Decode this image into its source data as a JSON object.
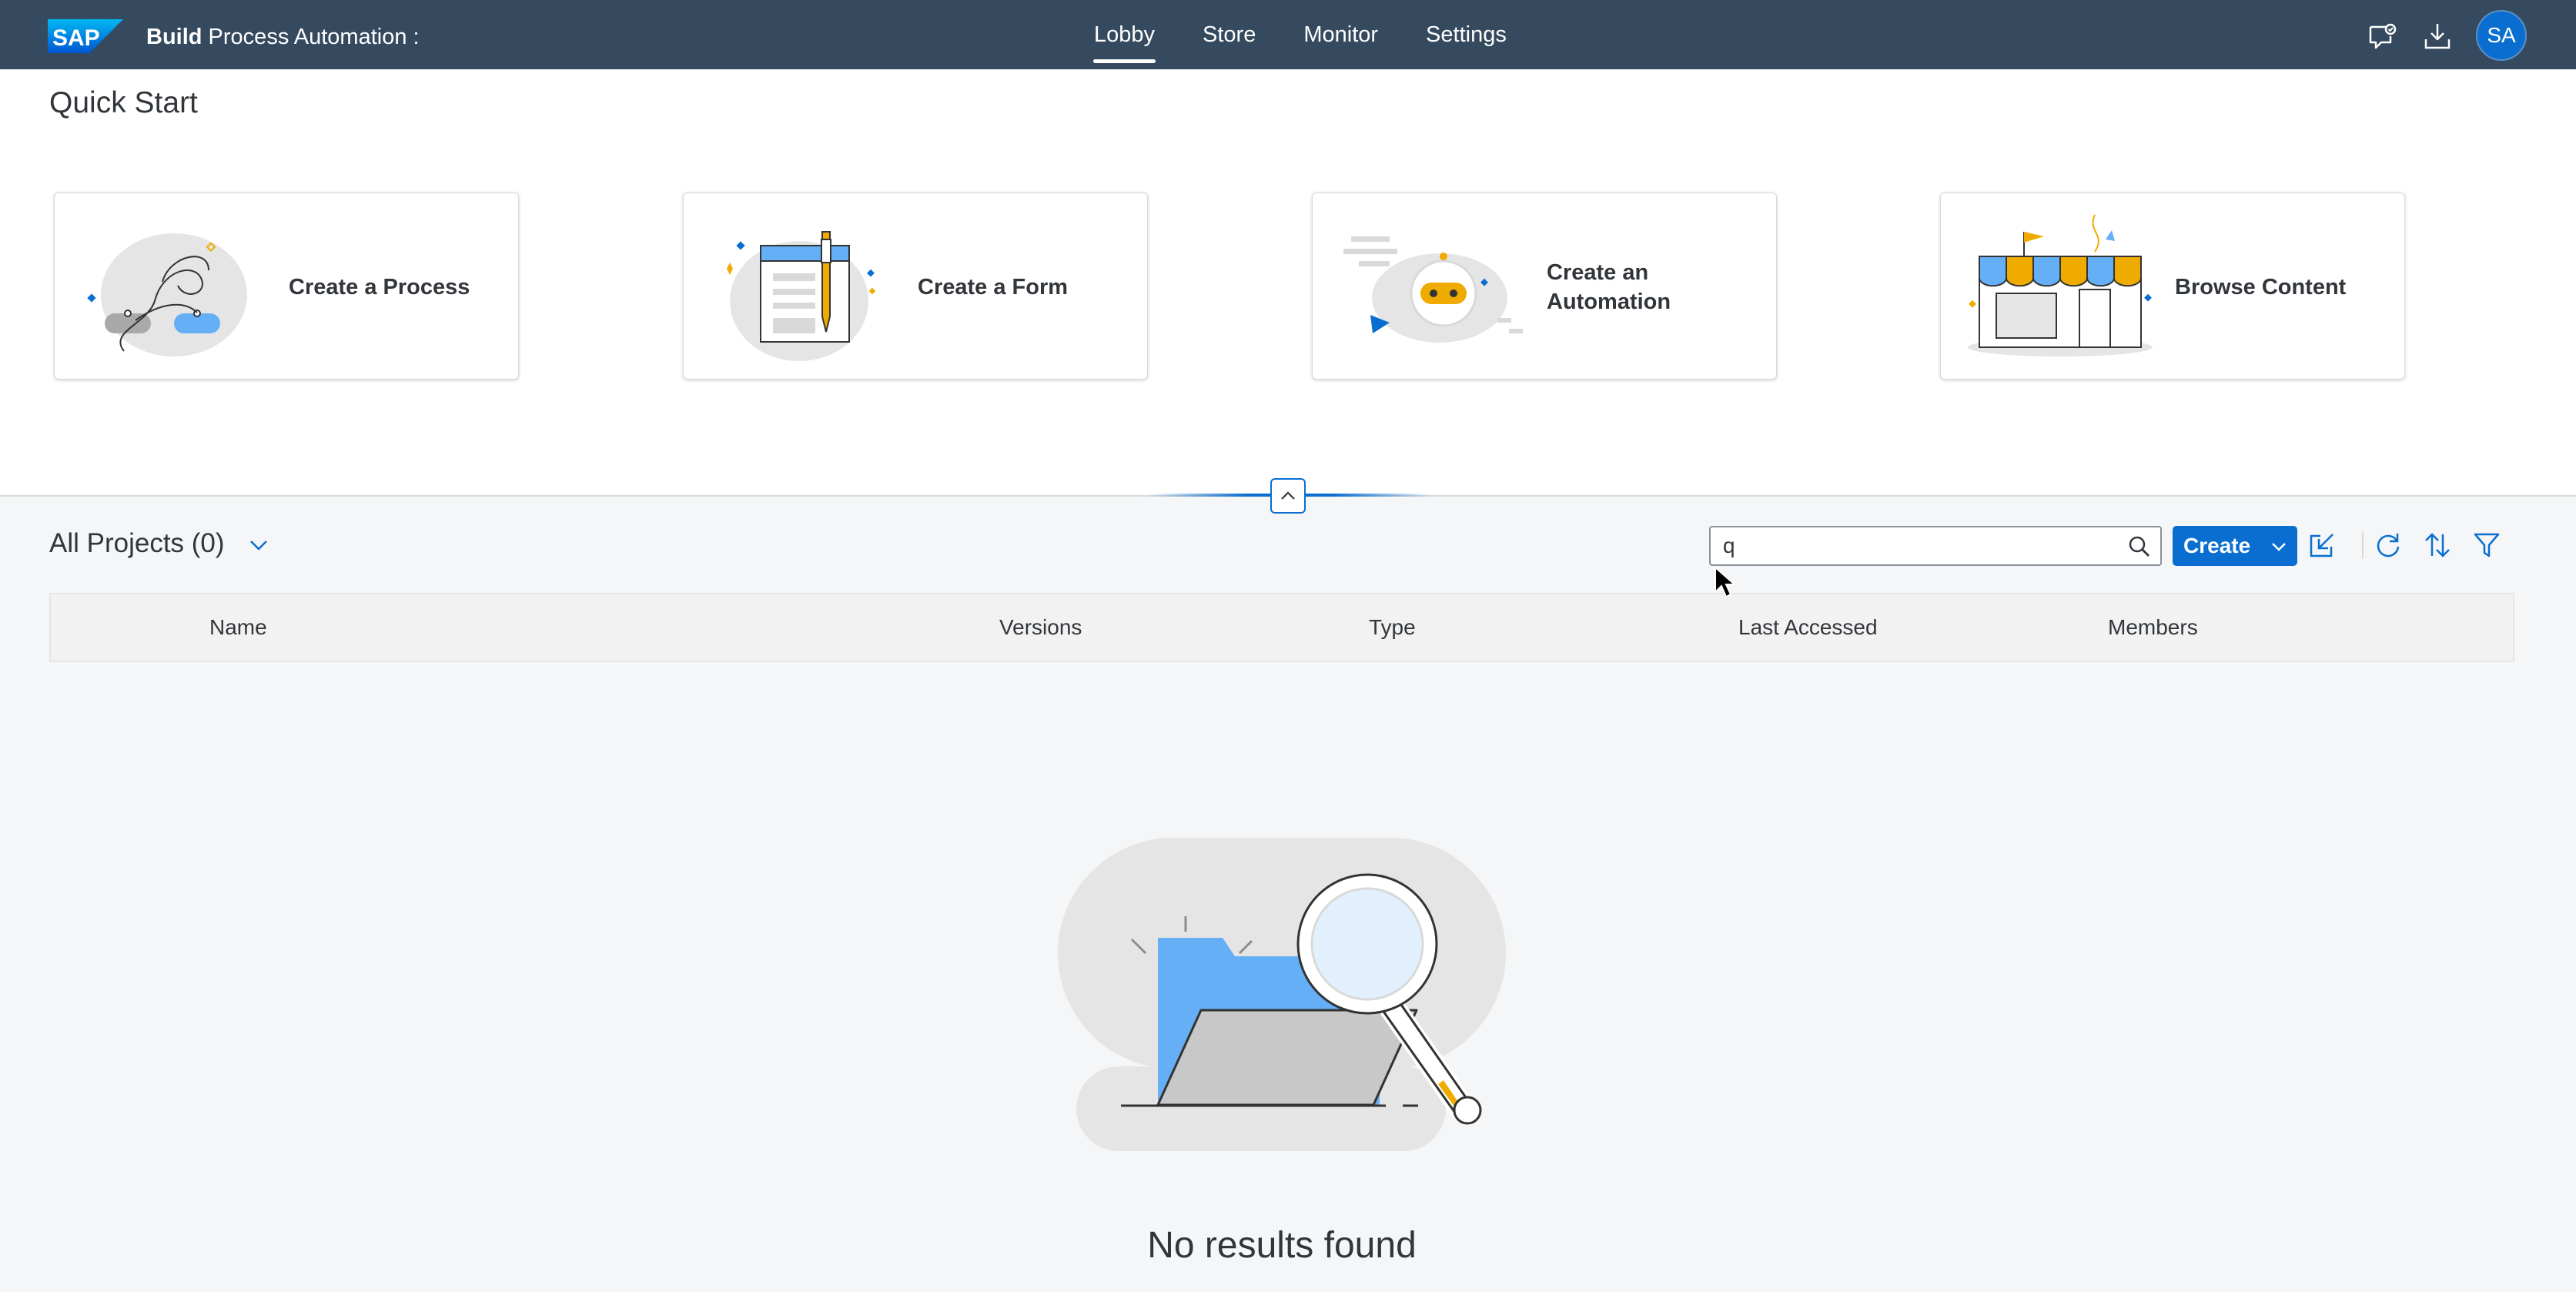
{
  "shell": {
    "logo_text": "SAP",
    "title_bold": "Build",
    "title_rest": " Process Automation :",
    "nav": [
      {
        "label": "Lobby",
        "active": true
      },
      {
        "label": "Store",
        "active": false
      },
      {
        "label": "Monitor",
        "active": false
      },
      {
        "label": "Settings",
        "active": false
      }
    ],
    "icons": [
      "feedback-icon",
      "download-icon"
    ],
    "avatar_initials": "SA"
  },
  "quick_start": {
    "title": "Quick Start",
    "tiles": [
      {
        "label": "Create a Process",
        "icon": "process-illustration"
      },
      {
        "label": "Create a Form",
        "icon": "form-illustration"
      },
      {
        "label": "Create an Automation",
        "icon": "automation-illustration"
      },
      {
        "label": "Browse Content",
        "icon": "store-illustration"
      }
    ]
  },
  "projects": {
    "title": "All Projects (0)",
    "search": {
      "value": "q",
      "placeholder": ""
    },
    "create_label": "Create",
    "columns": [
      "Name",
      "Versions",
      "Type",
      "Last Accessed",
      "Members"
    ],
    "rows": [],
    "empty_text": "No results found"
  },
  "colors": {
    "shell_bg": "#354a5f",
    "accent": "#0a6ed1",
    "page_bg": "#f5f6f7"
  }
}
